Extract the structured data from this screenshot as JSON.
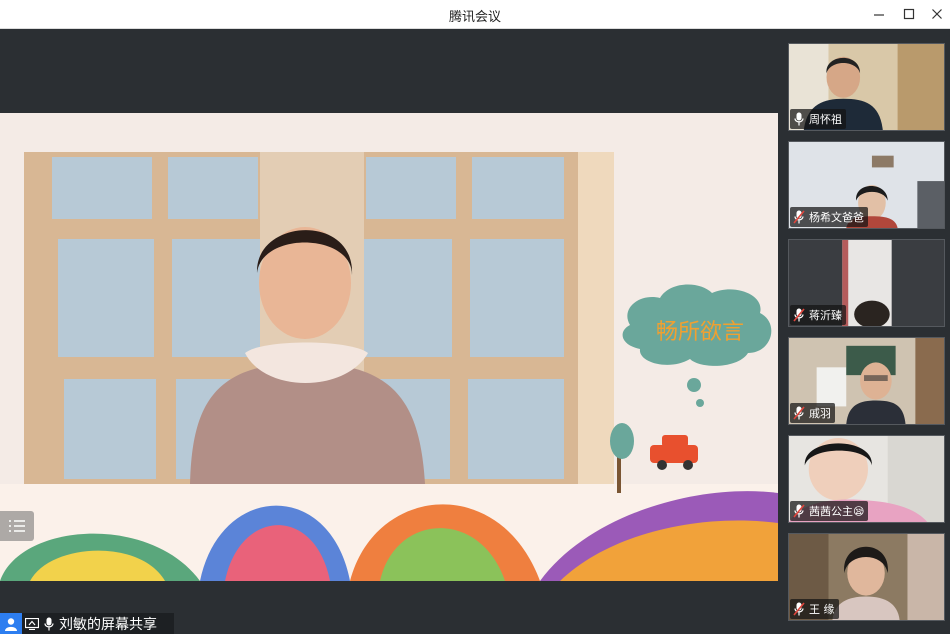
{
  "window": {
    "title": "腾讯会议",
    "minimize_icon": "minimize-icon",
    "maximize_icon": "maximize-icon",
    "close_icon": "close-icon"
  },
  "shared_screen": {
    "banner_text": "畅所欲言",
    "list_icon": "list-icon"
  },
  "status_bar": {
    "user_icon": "user-icon",
    "screen_icon": "screen-share-icon",
    "mic_icon": "mic-icon",
    "label": "刘敏的屏幕共享"
  },
  "participants": [
    {
      "name": "周怀祖",
      "mic": "mic-icon",
      "muted": false
    },
    {
      "name": "杨希文爸爸",
      "mic": "mic-muted-icon",
      "muted": true
    },
    {
      "name": "蒋沂臻",
      "mic": "mic-muted-icon",
      "muted": true
    },
    {
      "name": "戚羽",
      "mic": "mic-muted-icon",
      "muted": true
    },
    {
      "name": "茜茜公主😪",
      "mic": "mic-muted-icon",
      "muted": true
    },
    {
      "name": "王 缘",
      "mic": "mic-muted-icon",
      "muted": true
    }
  ],
  "colors": {
    "accent": "#2d7ef0",
    "background": "#2b2f33",
    "muted_mic": "#e0453c"
  }
}
